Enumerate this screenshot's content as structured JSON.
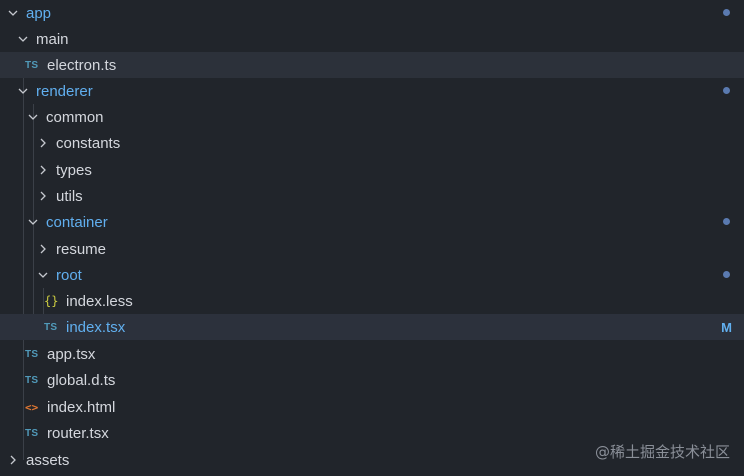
{
  "explorer": {
    "items": [
      {
        "label": "app",
        "type": "folder-open",
        "modified": true
      },
      {
        "label": "main",
        "type": "folder-open",
        "modified": false
      },
      {
        "label": "electron.ts",
        "type": "ts-file",
        "icon": "TS",
        "modified": false
      },
      {
        "label": "renderer",
        "type": "folder-open",
        "modified": true
      },
      {
        "label": "common",
        "type": "folder-open",
        "modified": false
      },
      {
        "label": "constants",
        "type": "folder-closed",
        "modified": false
      },
      {
        "label": "types",
        "type": "folder-closed",
        "modified": false
      },
      {
        "label": "utils",
        "type": "folder-closed",
        "modified": false
      },
      {
        "label": "container",
        "type": "folder-open",
        "modified": true
      },
      {
        "label": "resume",
        "type": "folder-closed",
        "modified": false
      },
      {
        "label": "root",
        "type": "folder-open",
        "modified": true
      },
      {
        "label": "index.less",
        "type": "less-file",
        "icon": "{}",
        "modified": false
      },
      {
        "label": "index.tsx",
        "type": "ts-file",
        "icon": "TS",
        "modified": true,
        "badge": "M"
      },
      {
        "label": "app.tsx",
        "type": "ts-file",
        "icon": "TS",
        "modified": false
      },
      {
        "label": "global.d.ts",
        "type": "ts-file",
        "icon": "TS",
        "modified": false
      },
      {
        "label": "index.html",
        "type": "html-file",
        "icon": "<>",
        "modified": false
      },
      {
        "label": "router.tsx",
        "type": "ts-file",
        "icon": "TS",
        "modified": false
      },
      {
        "label": "assets",
        "type": "folder-closed",
        "modified": false
      }
    ]
  },
  "watermark": "@稀土掘金技术社区",
  "colors": {
    "background": "#21252b",
    "text": "#d4d7dd",
    "modified": "#61afef",
    "dot": "#5a7ab0",
    "ts_icon": "#519aba",
    "html_icon": "#e37933"
  }
}
